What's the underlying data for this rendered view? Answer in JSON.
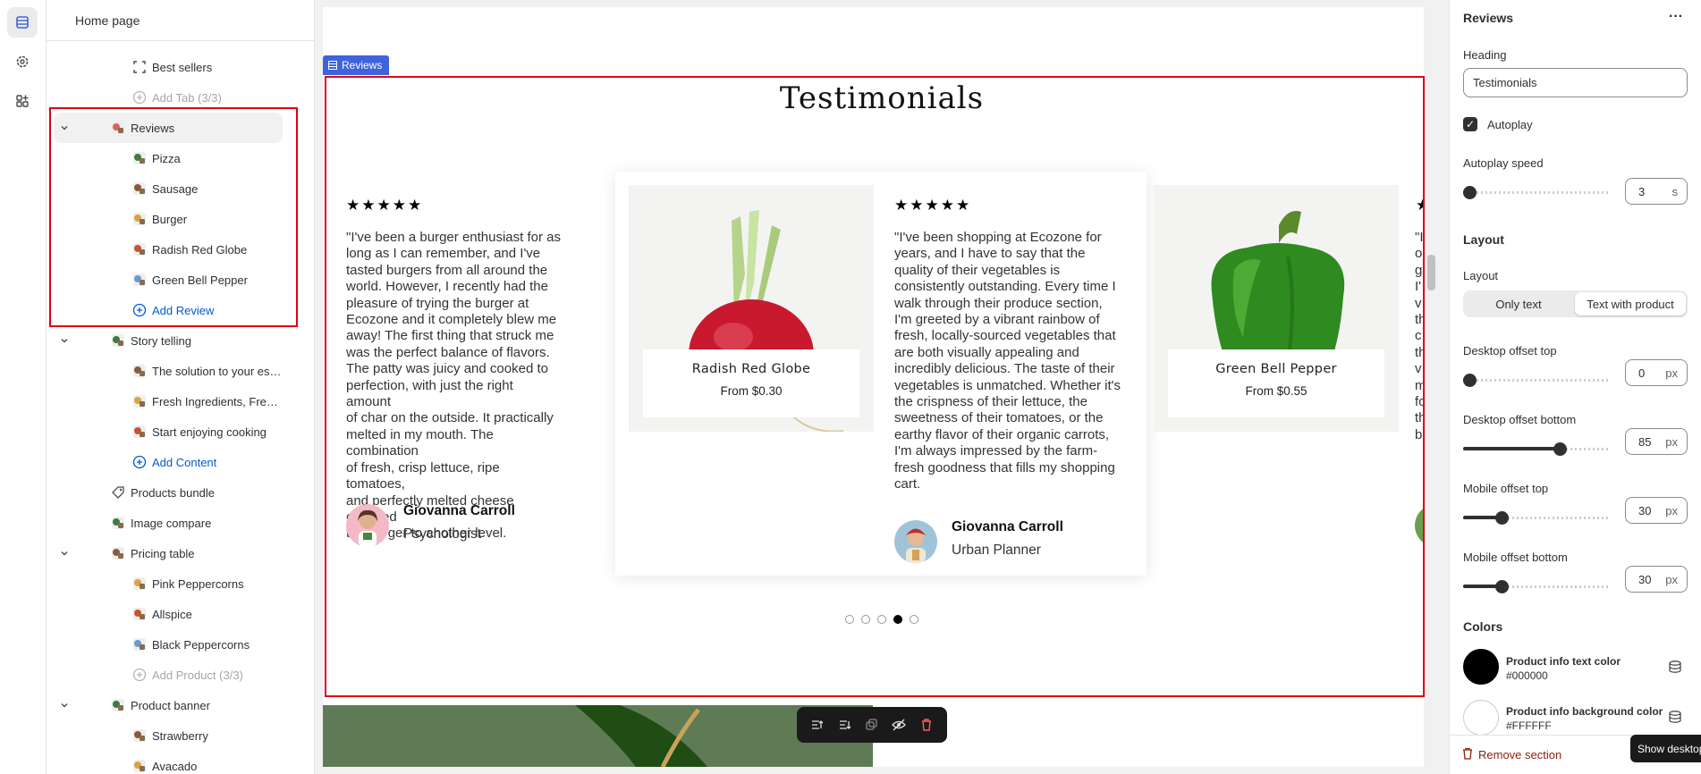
{
  "sidebar": {
    "title": "Home page",
    "items": [
      {
        "label": "Best sellers",
        "kind": "child",
        "icon": "focus-icon"
      },
      {
        "label": "Add Tab (3/3)",
        "kind": "muted",
        "icon": "add-circle-icon"
      },
      {
        "label": "Reviews",
        "kind": "parent-selected",
        "icon": "thumbnail-icon"
      },
      {
        "label": "Pizza",
        "kind": "child",
        "icon": "thumbnail-icon"
      },
      {
        "label": "Sausage",
        "kind": "child",
        "icon": "thumbnail-icon"
      },
      {
        "label": "Burger",
        "kind": "child",
        "icon": "thumbnail-icon"
      },
      {
        "label": "Radish Red Globe",
        "kind": "child",
        "icon": "thumbnail-icon"
      },
      {
        "label": "Green Bell Pepper",
        "kind": "child",
        "icon": "thumbnail-icon"
      },
      {
        "label": "Add Review",
        "kind": "add",
        "icon": "add-circle-icon"
      },
      {
        "label": "Story telling",
        "kind": "parent",
        "icon": "thumbnail-icon"
      },
      {
        "label": "The solution to your essentia...",
        "kind": "child",
        "icon": "thumbnail-icon"
      },
      {
        "label": "Fresh Ingredients, Fresh Ideas",
        "kind": "child",
        "icon": "thumbnail-icon"
      },
      {
        "label": "Start enjoying cooking",
        "kind": "child",
        "icon": "thumbnail-icon"
      },
      {
        "label": "Add Content",
        "kind": "add",
        "icon": "add-circle-icon"
      },
      {
        "label": "Products bundle",
        "kind": "section",
        "icon": "tag-icon"
      },
      {
        "label": "Image compare",
        "kind": "section",
        "icon": "thumbnail-icon"
      },
      {
        "label": "Pricing table",
        "kind": "parent",
        "icon": "thumbnail-icon"
      },
      {
        "label": "Pink Peppercorns",
        "kind": "child",
        "icon": "thumbnail-icon"
      },
      {
        "label": "Allspice",
        "kind": "child",
        "icon": "thumbnail-icon"
      },
      {
        "label": "Black Peppercorns",
        "kind": "child",
        "icon": "thumbnail-icon"
      },
      {
        "label": "Add Product (3/3)",
        "kind": "muted",
        "icon": "add-circle-icon"
      },
      {
        "label": "Product banner",
        "kind": "parent",
        "icon": "thumbnail-icon"
      },
      {
        "label": "Strawberry",
        "kind": "child",
        "icon": "thumbnail-icon"
      },
      {
        "label": "Avacado",
        "kind": "child",
        "icon": "thumbnail-icon"
      }
    ]
  },
  "preview": {
    "section_tag": "Reviews",
    "heading": "Testimonials",
    "reviews": [
      {
        "stars": "★★★★★",
        "text_lines": [
          "\"I've been a burger enthusiast for as",
          "long as I can remember, and I've",
          "tasted burgers from all around the",
          "world. However, I recently had the",
          "pleasure of trying the burger at",
          "Ecozone and it completely blew me",
          "away! The first thing that struck me",
          "was the perfect balance of flavors.",
          "The patty was juicy and cooked to",
          "perfection, with just the right amount",
          "of char on the outside. It practically",
          "melted in my mouth. The combination",
          "of fresh, crisp lettuce, ripe tomatoes,",
          "and perfectly melted cheese elevated",
          "the burger to another level."
        ],
        "name": "Giovanna Carroll",
        "role": "Psychologist"
      },
      {
        "stars": "★★★★★",
        "text_lines": [
          "\"I've been shopping at Ecozone for",
          "years, and I have to say that the",
          "quality of their vegetables is",
          "consistently outstanding. Every time I",
          "walk through their produce section,",
          "I'm greeted by a vibrant rainbow of",
          "fresh, locally-sourced vegetables that",
          "are both visually appealing and",
          "incredibly delicious. The taste of their",
          "vegetables is unmatched. Whether it's",
          "the crispness of their lettuce, the",
          "sweetness of their tomatoes, or the",
          "earthy flavor of their organic carrots,",
          "I'm always impressed by the farm-",
          "fresh goodness that fills my shopping",
          "cart."
        ],
        "name": "Giovanna Carroll",
        "role": "Urban Planner"
      }
    ],
    "partial_text_letters": [
      "\"I",
      "o",
      "g",
      "I'",
      "v",
      "th",
      "c",
      "th",
      "v",
      "m",
      "fo",
      "th",
      "b"
    ],
    "partial_star": "★",
    "products": [
      {
        "name": "Radish Red Globe",
        "price": "From $0.30"
      },
      {
        "name": "Green Bell Pepper",
        "price": "From $0.55"
      }
    ],
    "dots": [
      false,
      false,
      false,
      true,
      false
    ]
  },
  "settings": {
    "title": "Reviews",
    "heading_label": "Heading",
    "heading_value": "Testimonials",
    "autoplay_label": "Autoplay",
    "autoplay_checked": true,
    "autoplay_speed_label": "Autoplay speed",
    "autoplay_speed": {
      "value": "3",
      "unit": "s",
      "fraction": 0.0
    },
    "layout_heading": "Layout",
    "layout_label": "Layout",
    "layout_options": [
      "Only text",
      "Text with product"
    ],
    "layout_selected": "Text with product",
    "offsets": [
      {
        "label": "Desktop offset top",
        "value": "0",
        "unit": "px",
        "fraction": 0.0
      },
      {
        "label": "Desktop offset bottom",
        "value": "85",
        "unit": "px",
        "fraction": 0.68
      },
      {
        "label": "Mobile offset top",
        "value": "30",
        "unit": "px",
        "fraction": 0.24
      },
      {
        "label": "Mobile offset bottom",
        "value": "30",
        "unit": "px",
        "fraction": 0.24
      }
    ],
    "colors_heading": "Colors",
    "colors": [
      {
        "name": "Product info text color",
        "hex": "#000000"
      },
      {
        "name": "Product info background color",
        "hex": "#FFFFFF"
      }
    ],
    "remove_label": "Remove section",
    "tooltip": "Show desktop"
  }
}
